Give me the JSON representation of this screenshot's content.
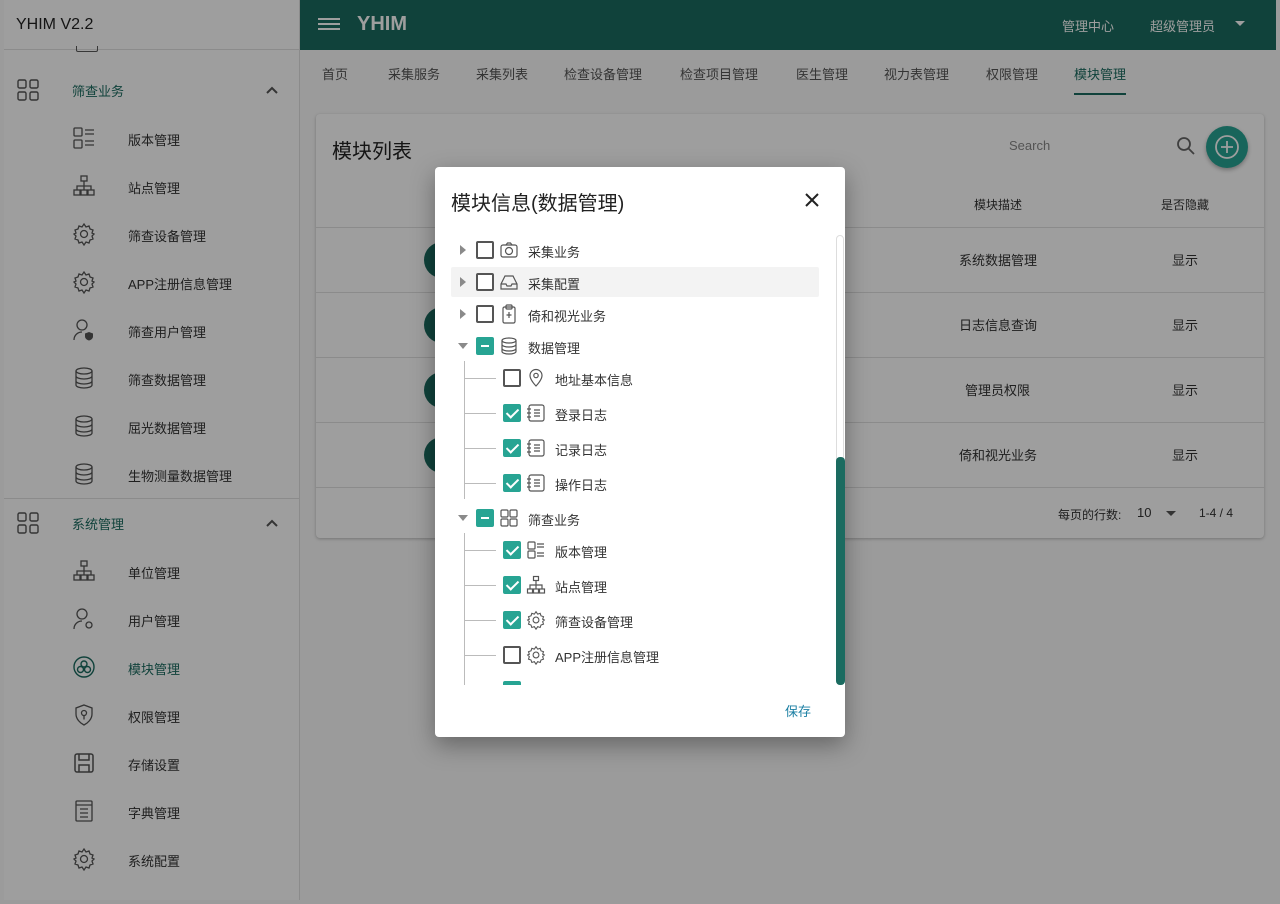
{
  "app": {
    "version_title": "YHIM V2.2",
    "title": "YHIM"
  },
  "topbar": {
    "admin_center": "管理中心",
    "user_role": "超级管理员"
  },
  "colors": {
    "primary": "#1b6b60",
    "accent": "#27a493",
    "link": "#1b7fa3"
  },
  "sidebar": {
    "groups": [
      {
        "label": "筛查业务",
        "icon": "grid-icon",
        "expanded": true,
        "items": [
          {
            "label": "版本管理",
            "icon": "list-grid-icon"
          },
          {
            "label": "站点管理",
            "icon": "sitemap-icon"
          },
          {
            "label": "筛查设备管理",
            "icon": "gear-icon"
          },
          {
            "label": "APP注册信息管理",
            "icon": "gear-icon"
          },
          {
            "label": "筛查用户管理",
            "icon": "user-shield-icon"
          },
          {
            "label": "筛查数据管理",
            "icon": "database-icon"
          },
          {
            "label": "屈光数据管理",
            "icon": "database-icon"
          },
          {
            "label": "生物测量数据管理",
            "icon": "database-icon"
          }
        ]
      },
      {
        "label": "系统管理",
        "icon": "grid-icon",
        "expanded": true,
        "items": [
          {
            "label": "单位管理",
            "icon": "sitemap-icon"
          },
          {
            "label": "用户管理",
            "icon": "user-gear-icon"
          },
          {
            "label": "模块管理",
            "icon": "module-icon",
            "active": true
          },
          {
            "label": "权限管理",
            "icon": "shield-icon"
          },
          {
            "label": "存储设置",
            "icon": "save-icon"
          },
          {
            "label": "字典管理",
            "icon": "book-icon"
          },
          {
            "label": "系统配置",
            "icon": "gear-icon"
          }
        ]
      }
    ]
  },
  "tabs": [
    "首页",
    "采集服务",
    "采集列表",
    "检查设备管理",
    "检查项目管理",
    "医生管理",
    "视力表管理",
    "权限管理",
    "模块管理"
  ],
  "active_tab": "模块管理",
  "card": {
    "title": "模块列表",
    "search_placeholder": "Search",
    "columns": {
      "desc": "模块描述",
      "hidden": "是否隐藏"
    },
    "rows": [
      {
        "desc": "系统数据管理",
        "visible": "显示"
      },
      {
        "desc": "日志信息查询",
        "visible": "显示"
      },
      {
        "desc": "管理员权限",
        "visible": "显示"
      },
      {
        "desc": "倚和视光业务",
        "visible": "显示"
      }
    ],
    "pager": {
      "rows_per_page_label": "每页的行数:",
      "rows_per_page": "10",
      "range": "1-4 / 4"
    }
  },
  "dialog": {
    "title": "模块信息(数据管理)",
    "save": "保存",
    "tree": [
      {
        "label": "采集业务",
        "icon": "camera-icon",
        "state": "unchecked",
        "expander": "collapsed"
      },
      {
        "label": "采集配置",
        "icon": "inbox-icon",
        "state": "unchecked",
        "expander": "collapsed"
      },
      {
        "label": "倚和视光业务",
        "icon": "clipboard-icon",
        "state": "unchecked",
        "expander": "collapsed"
      },
      {
        "label": "数据管理",
        "icon": "database-icon",
        "state": "indeterminate",
        "expander": "expanded",
        "children": [
          {
            "label": "地址基本信息",
            "icon": "location-icon",
            "state": "unchecked"
          },
          {
            "label": "登录日志",
            "icon": "log-icon",
            "state": "checked"
          },
          {
            "label": "记录日志",
            "icon": "log-icon",
            "state": "checked"
          },
          {
            "label": "操作日志",
            "icon": "log-icon",
            "state": "checked"
          }
        ]
      },
      {
        "label": "筛查业务",
        "icon": "grid-icon",
        "state": "indeterminate",
        "expander": "expanded",
        "children": [
          {
            "label": "版本管理",
            "icon": "list-grid-icon",
            "state": "checked"
          },
          {
            "label": "站点管理",
            "icon": "sitemap-icon",
            "state": "checked"
          },
          {
            "label": "筛查设备管理",
            "icon": "gear-icon",
            "state": "checked"
          },
          {
            "label": "APP注册信息管理",
            "icon": "gear-icon",
            "state": "unchecked"
          }
        ]
      }
    ]
  }
}
